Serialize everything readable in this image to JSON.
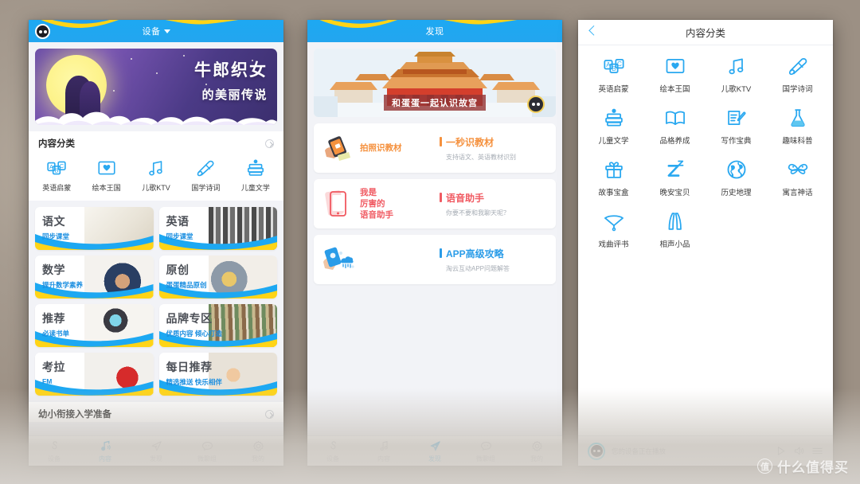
{
  "colors": {
    "brand_blue": "#1da8f2",
    "accent_yellow": "#ffd417",
    "card_title": "#4c5057",
    "card_sub": "#1a8ee0",
    "orange": "#f5913e",
    "red": "#f05a62",
    "tab_active": "#2cabf0",
    "tab_inactive": "#b9bdc4"
  },
  "phone1": {
    "header": {
      "title": "设备",
      "avatar_icon": "robot-avatar-icon",
      "caret_icon": "chevron-down-icon"
    },
    "banner": {
      "line1": "牛郎织女",
      "line2": "的美丽传说"
    },
    "section_content": {
      "title": "内容分类",
      "chevron_icon": "chevron-right-circle-icon"
    },
    "categories": [
      {
        "label": "英语启蒙",
        "icon": "abc-blocks-icon"
      },
      {
        "label": "绘本王国",
        "icon": "picture-book-heart-icon"
      },
      {
        "label": "儿歌KTV",
        "icon": "music-note-icon"
      },
      {
        "label": "国学诗词",
        "icon": "scroll-icon"
      },
      {
        "label": "儿童文学",
        "icon": "books-apple-icon"
      }
    ],
    "cards": [
      {
        "title": "语文",
        "sub": "同步课堂",
        "photo": "chinese-handwriting-photo"
      },
      {
        "title": "英语",
        "sub": "同步课堂",
        "photo": "english-books-photo"
      },
      {
        "title": "数学",
        "sub": "提升数学素养",
        "photo": "boy-reading-photo"
      },
      {
        "title": "原创",
        "sub": "蛋蛋精品原创",
        "photo": "family-reading-photo"
      },
      {
        "title": "推荐",
        "sub": "必读书单",
        "photo": "girl-binoculars-photo"
      },
      {
        "title": "品牌专区",
        "sub": "优质内容 倾心打造",
        "photo": "bookshelf-photo"
      },
      {
        "title": "考拉",
        "sub": "FM",
        "photo": "red-headphones-photo"
      },
      {
        "title": "每日推荐",
        "sub": "精选推送 快乐相伴",
        "photo": "father-daughter-photo"
      }
    ],
    "section_prep": {
      "title": "幼小衔接入学准备",
      "chevron_icon": "chevron-right-circle-icon"
    },
    "tabs": [
      {
        "label": "设备",
        "icon": "device-s-icon",
        "active": false
      },
      {
        "label": "内容",
        "icon": "music-note-icon",
        "active": true
      },
      {
        "label": "发现",
        "icon": "paper-plane-icon",
        "active": false
      },
      {
        "label": "微聊组",
        "icon": "chat-bubble-icon",
        "active": false
      },
      {
        "label": "我的",
        "icon": "gear-icon",
        "active": false
      }
    ]
  },
  "phone2": {
    "header": {
      "title": "发现"
    },
    "banner": {
      "caption": "和蛋蛋一起认识故宫",
      "image": "forbidden-city-illustration",
      "mascot_icon": "egg-mascot-icon"
    },
    "cards": [
      {
        "left_text": "拍照识教材",
        "left_color": "#f5913e",
        "title": "一秒识教材",
        "title_color": "#f5913e",
        "desc": "支持语文、英语教材识别",
        "illu": "phone-camera-book-icon"
      },
      {
        "left_text": "我是\n厉害的\n语音助手",
        "left_color": "#f05a62",
        "title": "语音助手",
        "title_color": "#f05a62",
        "desc": "你要不要和我聊天呢？",
        "illu": "red-phone-icon"
      },
      {
        "left_text": "",
        "left_color": "#2a9ce8",
        "title": "APP高级攻略",
        "title_color": "#2a9ce8",
        "desc": "淘云互动APP问题解答",
        "illu": "hand-phone-cloud-icon"
      }
    ],
    "tabs": [
      {
        "label": "设备",
        "icon": "device-s-icon",
        "active": false
      },
      {
        "label": "内容",
        "icon": "music-note-icon",
        "active": false
      },
      {
        "label": "发现",
        "icon": "paper-plane-icon",
        "active": true
      },
      {
        "label": "微聊组",
        "icon": "chat-bubble-icon",
        "active": false
      },
      {
        "label": "我的",
        "icon": "gear-icon",
        "active": false
      }
    ]
  },
  "phone3": {
    "header": {
      "title": "内容分类",
      "back_icon": "back-chevron-icon"
    },
    "categories": [
      {
        "label": "英语启蒙",
        "icon": "abc-blocks-icon"
      },
      {
        "label": "绘本王国",
        "icon": "picture-book-heart-icon"
      },
      {
        "label": "儿歌KTV",
        "icon": "music-note-icon"
      },
      {
        "label": "国学诗词",
        "icon": "scroll-icon"
      },
      {
        "label": "儿童文学",
        "icon": "books-apple-icon"
      },
      {
        "label": "品格养成",
        "icon": "open-book-icon"
      },
      {
        "label": "写作宝典",
        "icon": "pencil-paper-icon"
      },
      {
        "label": "趣味科普",
        "icon": "flask-icon"
      },
      {
        "label": "故事宝盒",
        "icon": "gift-box-icon"
      },
      {
        "label": "晚安宝贝",
        "icon": "sleep-z-icon"
      },
      {
        "label": "历史地理",
        "icon": "globe-icon"
      },
      {
        "label": "寓言神话",
        "icon": "butterfly-icon"
      },
      {
        "label": "戏曲评书",
        "icon": "fan-icon"
      },
      {
        "label": "相声小品",
        "icon": "folding-screen-icon"
      }
    ],
    "player": {
      "status": "您的设备正在播放",
      "avatar_icon": "robot-avatar-icon",
      "play_icon": "play-icon",
      "volume_icon": "volume-icon",
      "list_icon": "playlist-icon"
    }
  },
  "watermark": {
    "mark": "值",
    "text": "什么值得买"
  }
}
